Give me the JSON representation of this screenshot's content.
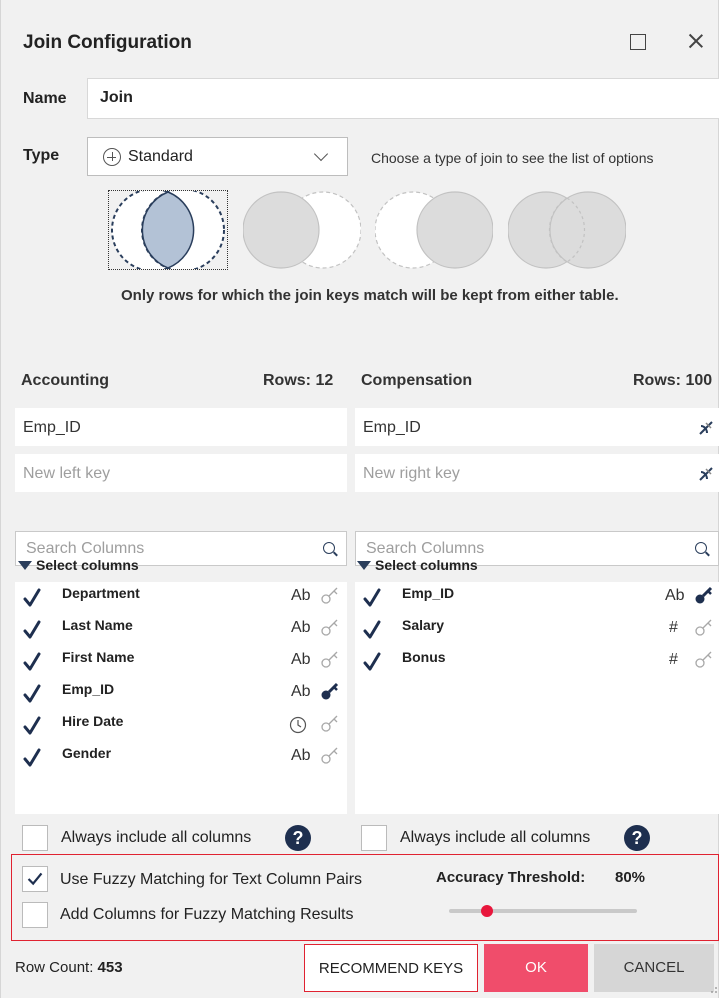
{
  "dialog": {
    "title": "Join Configuration",
    "name_label": "Name",
    "name_value": "Join",
    "type_label": "Type",
    "type_value": "Standard",
    "type_hint": "Choose a type of join to see the list of options",
    "join_description": "Only rows for which the join keys match will be kept from either table.",
    "join_types": [
      "inner-join",
      "left-only",
      "right-only",
      "full-outer"
    ],
    "selected_join_type": "inner-join"
  },
  "left": {
    "title": "Accounting",
    "rows": "Rows: 12",
    "key": "Emp_ID",
    "new_key_placeholder": "New left key",
    "search_placeholder": "Search Columns",
    "select_header": "Select columns",
    "columns": [
      {
        "name": "Department",
        "type": "Ab",
        "is_key": false,
        "checked": true
      },
      {
        "name": "Last Name",
        "type": "Ab",
        "is_key": false,
        "checked": true
      },
      {
        "name": "First Name",
        "type": "Ab",
        "is_key": false,
        "checked": true
      },
      {
        "name": "Emp_ID",
        "type": "Ab",
        "is_key": true,
        "checked": true
      },
      {
        "name": "Hire Date",
        "type": "clock-icon",
        "is_key": false,
        "checked": true
      },
      {
        "name": "Gender",
        "type": "Ab",
        "is_key": false,
        "checked": true
      }
    ],
    "always_include": "Always include all columns"
  },
  "right": {
    "title": "Compensation",
    "rows": "Rows: 100",
    "key": "Emp_ID",
    "new_key_placeholder": "New right key",
    "search_placeholder": "Search Columns",
    "select_header": "Select columns",
    "columns": [
      {
        "name": "Emp_ID",
        "type": "Ab",
        "is_key": true,
        "checked": true
      },
      {
        "name": "Salary",
        "type": "#",
        "is_key": false,
        "checked": true
      },
      {
        "name": "Bonus",
        "type": "#",
        "is_key": false,
        "checked": true
      }
    ],
    "always_include": "Always include all columns"
  },
  "fuzzy": {
    "use_label": "Use Fuzzy Matching for Text Column Pairs",
    "use_checked": true,
    "add_label": "Add Columns for Fuzzy Matching Results",
    "add_checked": false,
    "accuracy_label": "Accuracy Threshold:",
    "accuracy_value": "80%",
    "slider_level": 0.2
  },
  "footer": {
    "row_count_label": "Row Count:",
    "row_count_value": "453",
    "recommend": "RECOMMEND KEYS",
    "ok": "OK",
    "cancel": "CANCEL"
  },
  "colors": {
    "accent": "#f04d6b",
    "danger_border": "#e02231",
    "navy": "#1e2f4f",
    "venn_selected_fill": "#b3c2d6"
  }
}
